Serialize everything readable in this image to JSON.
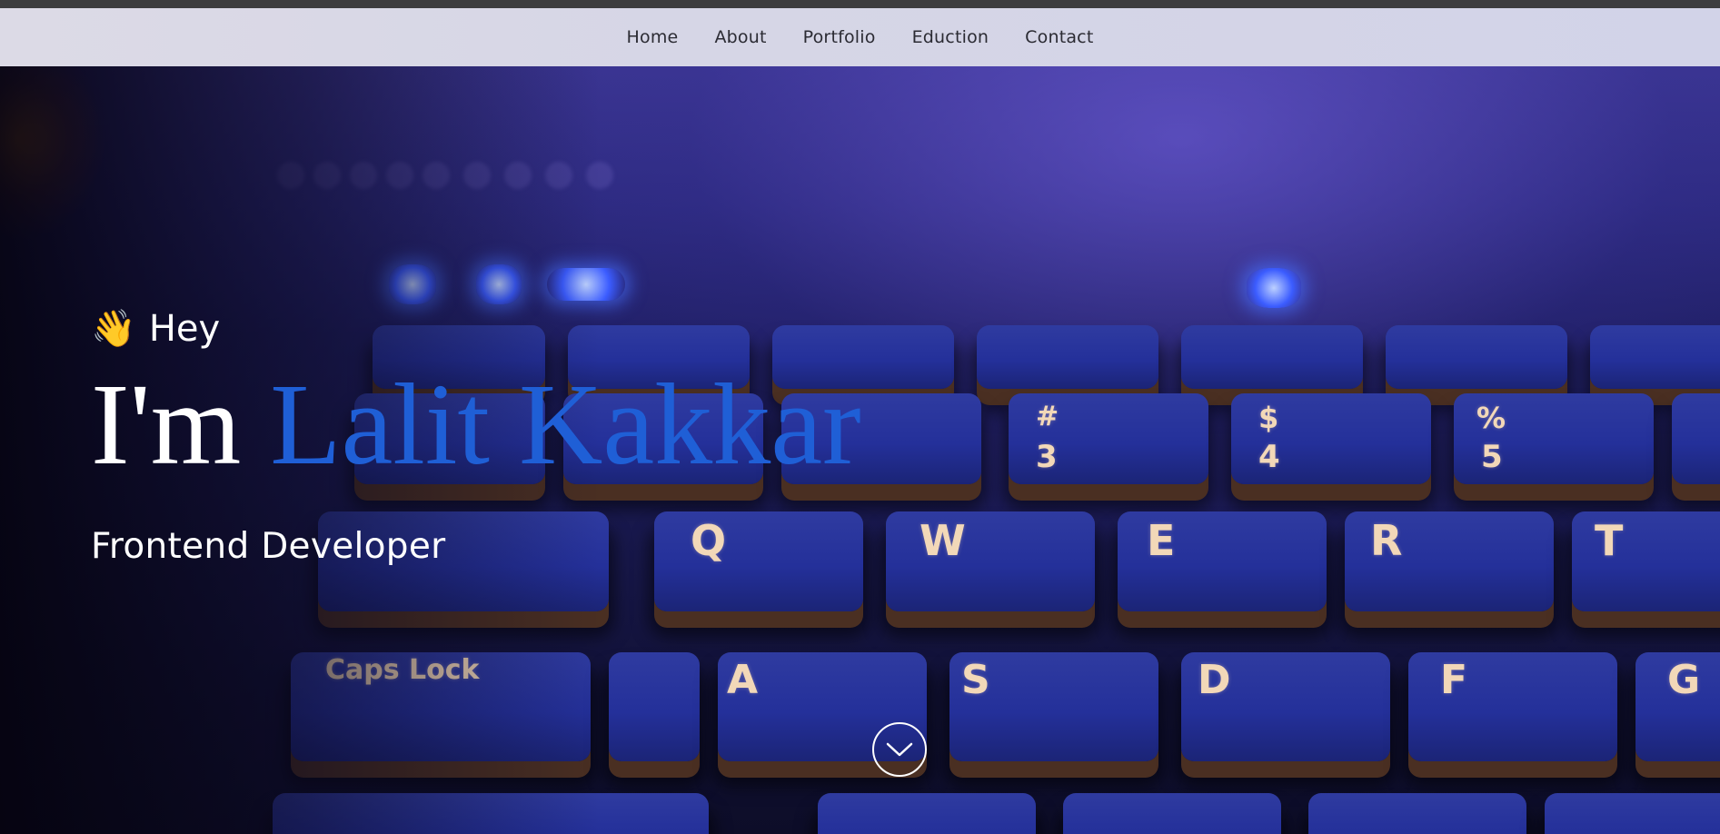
{
  "nav": {
    "items": [
      {
        "label": "Home"
      },
      {
        "label": "About"
      },
      {
        "label": "Portfolio"
      },
      {
        "label": "Eduction"
      },
      {
        "label": "Contact"
      }
    ]
  },
  "hero": {
    "greeting_icon": "👋",
    "greeting": "Hey",
    "intro": "I'm ",
    "name": "Lalit Kakkar",
    "role": "Frontend Developer",
    "accent_color": "#1f5fd6",
    "scroll_icon": "chevron-down-icon",
    "background": "keyboard photo with blue-purple lighting",
    "keys": [
      "#",
      "3",
      "$",
      "4",
      "%",
      "5",
      "Q",
      "W",
      "E",
      "R",
      "T",
      "Caps Lock",
      "A",
      "S",
      "D",
      "F",
      "G"
    ]
  }
}
